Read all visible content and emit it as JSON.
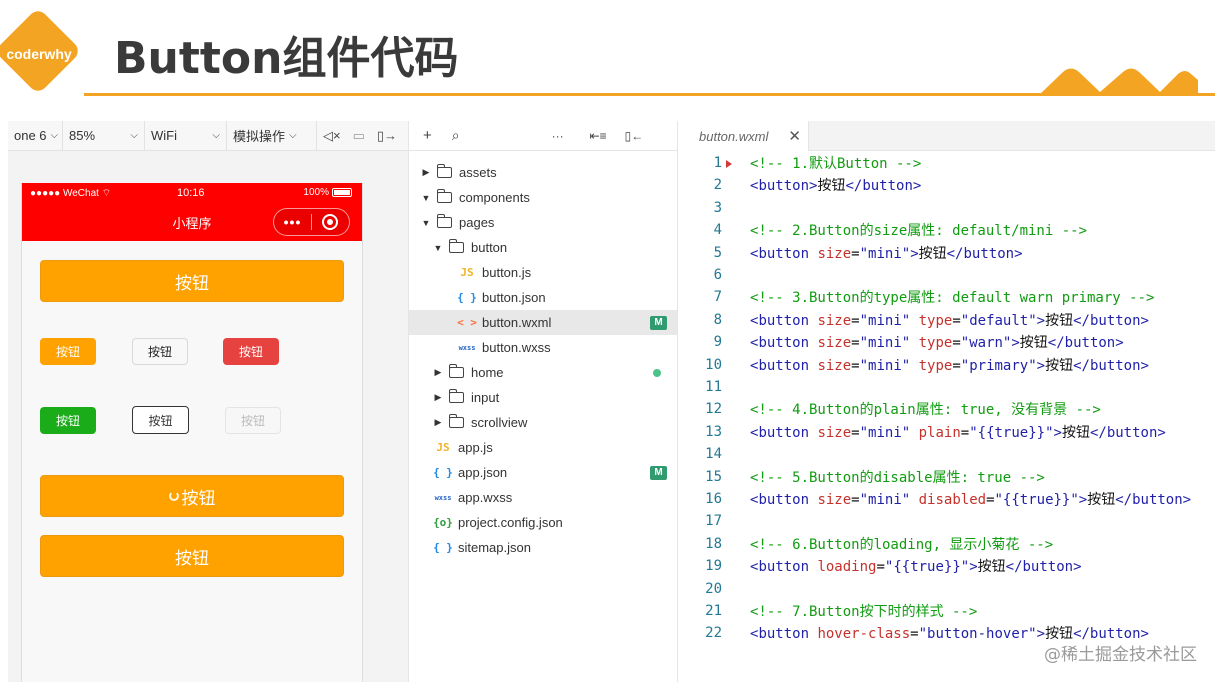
{
  "slide": {
    "logo_text": "coderwhy",
    "title": "Button组件代码",
    "brand_color": "#f4a423"
  },
  "simulator_toolbar": {
    "device": "one 6",
    "zoom": "85%",
    "network": "WiFi",
    "simulate": "模拟操作"
  },
  "phone": {
    "status_left": "●●●●● WeChat",
    "time": "10:16",
    "battery": "100%",
    "nav_title": "小程序",
    "capsule_dots": "•••",
    "header_color": "#ff0000"
  },
  "buttons": {
    "default_label": "按钮",
    "mini_size_label": "按钮",
    "type_default_label": "按钮",
    "type_warn_label": "按钮",
    "type_primary_label": "按钮",
    "plain_label": "按钮",
    "disabled_label": "按钮",
    "loading_label": "按钮",
    "hover_label": "按钮"
  },
  "explorer": {
    "items": [
      {
        "name": "assets",
        "kind": "folder",
        "expanded": false,
        "depth": 0
      },
      {
        "name": "components",
        "kind": "folder",
        "expanded": true,
        "depth": 0
      },
      {
        "name": "pages",
        "kind": "folder",
        "expanded": true,
        "depth": 0
      },
      {
        "name": "button",
        "kind": "folder",
        "expanded": true,
        "depth": 1
      },
      {
        "name": "button.js",
        "kind": "js",
        "depth": 2
      },
      {
        "name": "button.json",
        "kind": "json",
        "depth": 2
      },
      {
        "name": "button.wxml",
        "kind": "wxml",
        "depth": 2,
        "badge": "M",
        "selected": true
      },
      {
        "name": "button.wxss",
        "kind": "wxss",
        "depth": 2
      },
      {
        "name": "home",
        "kind": "folder",
        "expanded": false,
        "depth": 1,
        "dot": true
      },
      {
        "name": "input",
        "kind": "folder",
        "expanded": false,
        "depth": 1
      },
      {
        "name": "scrollview",
        "kind": "folder",
        "expanded": false,
        "depth": 1
      },
      {
        "name": "app.js",
        "kind": "js",
        "depth": 0
      },
      {
        "name": "app.json",
        "kind": "json",
        "depth": 0,
        "badge": "M"
      },
      {
        "name": "app.wxss",
        "kind": "wxss",
        "depth": 0
      },
      {
        "name": "project.config.json",
        "kind": "cfg",
        "depth": 0
      },
      {
        "name": "sitemap.json",
        "kind": "json",
        "depth": 0
      }
    ],
    "icon_glyphs": {
      "js": "JS",
      "json": "{ }",
      "wxml": "< >",
      "wxss": "wxss",
      "cfg": "{o}"
    }
  },
  "editor": {
    "tab_name": "button.wxml",
    "close_glyph": "✕",
    "lines": [
      [
        [
          "c",
          "<!-- 1.默认Button -->"
        ]
      ],
      [
        [
          "g",
          "<"
        ],
        [
          "t",
          "button"
        ],
        [
          "g",
          ">"
        ],
        [
          "x",
          "按钮"
        ],
        [
          "g",
          "</"
        ],
        [
          "t",
          "button"
        ],
        [
          "g",
          ">"
        ]
      ],
      [],
      [
        [
          "c",
          "<!-- 2.Button的size属性: default/mini -->"
        ]
      ],
      [
        [
          "g",
          "<"
        ],
        [
          "t",
          "button"
        ],
        [
          "x",
          " "
        ],
        [
          "a",
          "size"
        ],
        [
          "x",
          "="
        ],
        [
          "s",
          "\"mini\""
        ],
        [
          "g",
          ">"
        ],
        [
          "x",
          "按钮"
        ],
        [
          "g",
          "</"
        ],
        [
          "t",
          "button"
        ],
        [
          "g",
          ">"
        ]
      ],
      [],
      [
        [
          "c",
          "<!-- 3.Button的type属性: default warn primary -->"
        ]
      ],
      [
        [
          "g",
          "<"
        ],
        [
          "t",
          "button"
        ],
        [
          "x",
          " "
        ],
        [
          "a",
          "size"
        ],
        [
          "x",
          "="
        ],
        [
          "s",
          "\"mini\""
        ],
        [
          "x",
          " "
        ],
        [
          "a",
          "type"
        ],
        [
          "x",
          "="
        ],
        [
          "s",
          "\"default\""
        ],
        [
          "g",
          ">"
        ],
        [
          "x",
          "按钮"
        ],
        [
          "g",
          "</"
        ],
        [
          "t",
          "button"
        ],
        [
          "g",
          ">"
        ]
      ],
      [
        [
          "g",
          "<"
        ],
        [
          "t",
          "button"
        ],
        [
          "x",
          " "
        ],
        [
          "a",
          "size"
        ],
        [
          "x",
          "="
        ],
        [
          "s",
          "\"mini\""
        ],
        [
          "x",
          " "
        ],
        [
          "a",
          "type"
        ],
        [
          "x",
          "="
        ],
        [
          "s",
          "\"warn\""
        ],
        [
          "g",
          ">"
        ],
        [
          "x",
          "按钮"
        ],
        [
          "g",
          "</"
        ],
        [
          "t",
          "button"
        ],
        [
          "g",
          ">"
        ]
      ],
      [
        [
          "g",
          "<"
        ],
        [
          "t",
          "button"
        ],
        [
          "x",
          " "
        ],
        [
          "a",
          "size"
        ],
        [
          "x",
          "="
        ],
        [
          "s",
          "\"mini\""
        ],
        [
          "x",
          " "
        ],
        [
          "a",
          "type"
        ],
        [
          "x",
          "="
        ],
        [
          "s",
          "\"primary\""
        ],
        [
          "g",
          ">"
        ],
        [
          "x",
          "按钮"
        ],
        [
          "g",
          "</"
        ],
        [
          "t",
          "button"
        ],
        [
          "g",
          ">"
        ]
      ],
      [],
      [
        [
          "c",
          "<!-- 4.Button的plain属性: true, 没有背景 -->"
        ]
      ],
      [
        [
          "g",
          "<"
        ],
        [
          "t",
          "button"
        ],
        [
          "x",
          " "
        ],
        [
          "a",
          "size"
        ],
        [
          "x",
          "="
        ],
        [
          "s",
          "\"mini\""
        ],
        [
          "x",
          " "
        ],
        [
          "a",
          "plain"
        ],
        [
          "x",
          "="
        ],
        [
          "s",
          "\"{{true}}\""
        ],
        [
          "g",
          ">"
        ],
        [
          "x",
          "按钮"
        ],
        [
          "g",
          "</"
        ],
        [
          "t",
          "button"
        ],
        [
          "g",
          ">"
        ]
      ],
      [],
      [
        [
          "c",
          "<!-- 5.Button的disable属性: true -->"
        ]
      ],
      [
        [
          "g",
          "<"
        ],
        [
          "t",
          "button"
        ],
        [
          "x",
          " "
        ],
        [
          "a",
          "size"
        ],
        [
          "x",
          "="
        ],
        [
          "s",
          "\"mini\""
        ],
        [
          "x",
          " "
        ],
        [
          "a",
          "disabled"
        ],
        [
          "x",
          "="
        ],
        [
          "s",
          "\"{{true}}\""
        ],
        [
          "g",
          ">"
        ],
        [
          "x",
          "按钮"
        ],
        [
          "g",
          "</"
        ],
        [
          "t",
          "button"
        ],
        [
          "g",
          ">"
        ]
      ],
      [],
      [
        [
          "c",
          "<!-- 6.Button的loading, 显示小菊花 -->"
        ]
      ],
      [
        [
          "g",
          "<"
        ],
        [
          "t",
          "button"
        ],
        [
          "x",
          " "
        ],
        [
          "a",
          "loading"
        ],
        [
          "x",
          "="
        ],
        [
          "s",
          "\"{{true}}\""
        ],
        [
          "g",
          ">"
        ],
        [
          "x",
          "按钮"
        ],
        [
          "g",
          "</"
        ],
        [
          "t",
          "button"
        ],
        [
          "g",
          ">"
        ]
      ],
      [],
      [
        [
          "c",
          "<!-- 7.Button按下时的样式 -->"
        ]
      ],
      [
        [
          "g",
          "<"
        ],
        [
          "t",
          "button"
        ],
        [
          "x",
          " "
        ],
        [
          "a",
          "hover-class"
        ],
        [
          "x",
          "="
        ],
        [
          "s",
          "\"button-hover\""
        ],
        [
          "g",
          ">"
        ],
        [
          "x",
          "按钮"
        ],
        [
          "g",
          "</"
        ],
        [
          "t",
          "button"
        ],
        [
          "g",
          ">"
        ]
      ]
    ]
  },
  "watermark": "@稀土掘金技术社区"
}
